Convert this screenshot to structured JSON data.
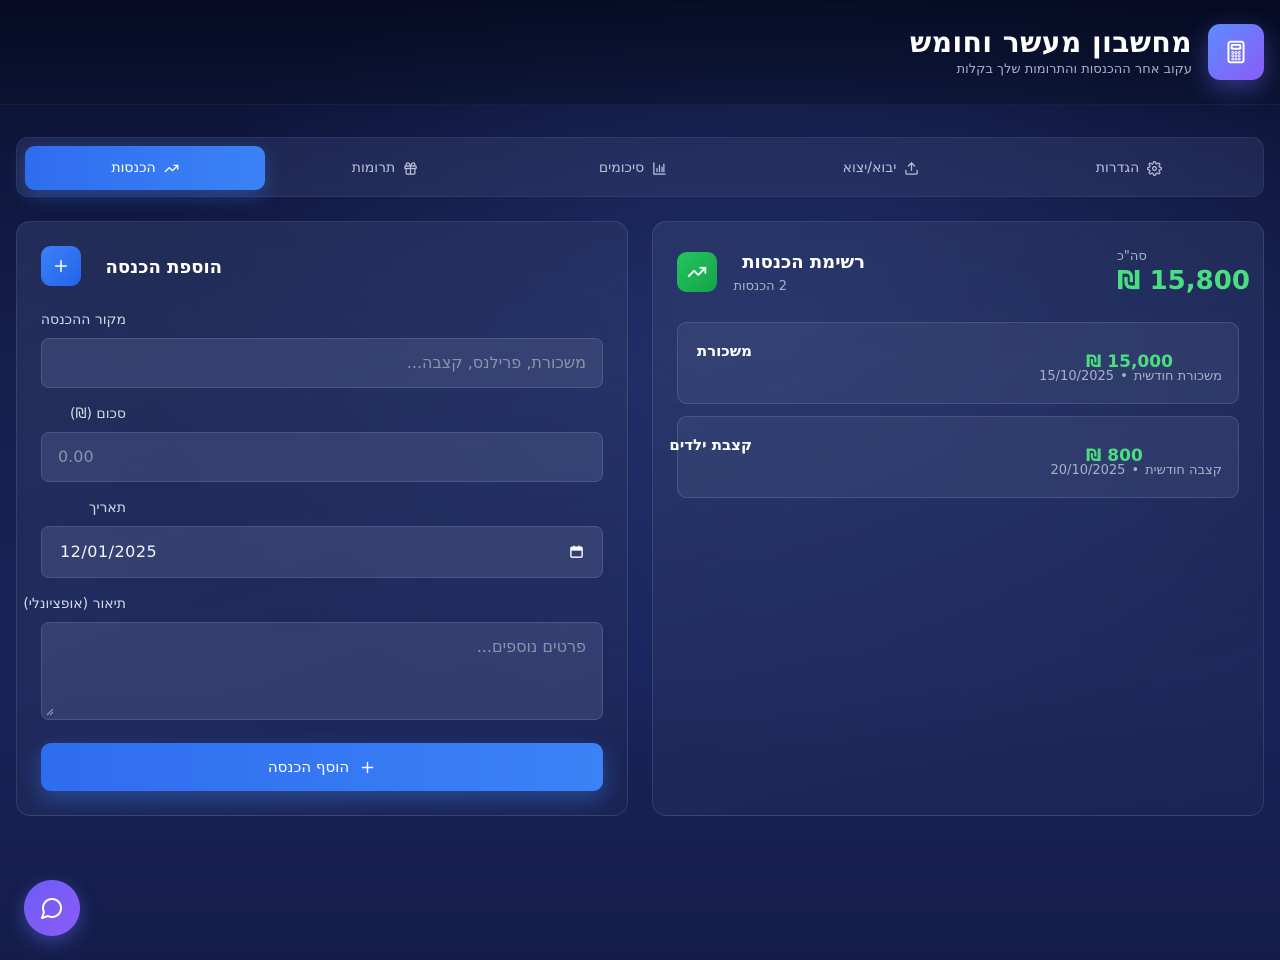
{
  "header": {
    "title": "מחשבון מעשר וחומש",
    "subtitle": "עקוב אחר ההכנסות והתרומות שלך בקלות",
    "icon": "calculator-icon"
  },
  "tabs": [
    {
      "label": "הכנסות",
      "icon": "trending-up-icon",
      "active": true
    },
    {
      "label": "תרומות",
      "icon": "gift-icon",
      "active": false
    },
    {
      "label": "סיכומים",
      "icon": "bar-chart-icon",
      "active": false
    },
    {
      "label": "יבוא/יצוא",
      "icon": "upload-icon",
      "active": false
    },
    {
      "label": "הגדרות",
      "icon": "gear-icon",
      "active": false
    }
  ],
  "income_list": {
    "title": "רשימת הכנסות",
    "count": "2 הכנסות",
    "total_label": "סה\"כ",
    "total_value": "15,800 ₪",
    "items": [
      {
        "name": "משכורת",
        "category": "משכורת חודשית",
        "date": "15/10/2025",
        "amount": "15,000 ₪"
      },
      {
        "name": "קצבת ילדים",
        "category": "קצבה חודשית",
        "date": "20/10/2025",
        "amount": "800 ₪"
      }
    ]
  },
  "income_form": {
    "title": "הוספת הכנסה",
    "source_label": "מקור ההכנסה",
    "source_placeholder": "משכורת, פרילנס, קצבה...",
    "amount_label": "סכום (₪)",
    "amount_placeholder": "0.00",
    "date_label": "תאריך",
    "date_value": "12/01/2025",
    "description_label": "תיאור (אופציונלי)",
    "description_placeholder": "פרטים נוספים...",
    "submit_label": "הוסף הכנסה"
  },
  "colors": {
    "accent": "#3b82f6",
    "positive": "#4ade80",
    "brand_gradient_start": "#5b8cff",
    "brand_gradient_end": "#8b5cf6"
  },
  "chat_button": {
    "icon": "chat-bubble-icon"
  }
}
